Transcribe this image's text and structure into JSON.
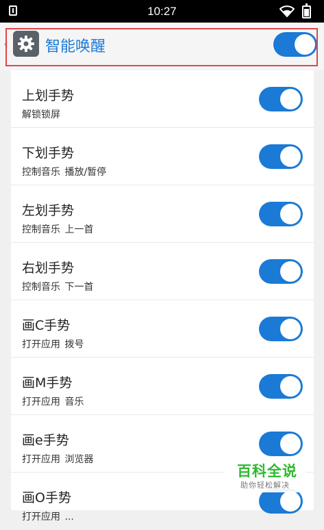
{
  "status_bar": {
    "time": "10:27"
  },
  "header": {
    "title": "智能唤醒",
    "toggle_on": true
  },
  "items": [
    {
      "title": "上划手势",
      "subtitle": "解锁锁屏",
      "toggle_on": true
    },
    {
      "title": "下划手势",
      "subtitle": "控制音乐 播放/暂停",
      "toggle_on": true
    },
    {
      "title": "左划手势",
      "subtitle": "控制音乐 上一首",
      "toggle_on": true
    },
    {
      "title": "右划手势",
      "subtitle": "控制音乐 下一首",
      "toggle_on": true
    },
    {
      "title": "画C手势",
      "subtitle": "打开应用 拨号",
      "toggle_on": true
    },
    {
      "title": "画M手势",
      "subtitle": "打开应用 音乐",
      "toggle_on": true
    },
    {
      "title": "画e手势",
      "subtitle": "打开应用 浏览器",
      "toggle_on": true
    },
    {
      "title": "画O手势",
      "subtitle": "打开应用 ...",
      "toggle_on": true
    }
  ],
  "watermark": {
    "title": "百科全说",
    "subtitle": "助你轻松解决"
  },
  "colors": {
    "accent": "#1a7ad6",
    "highlight": "#e0444a",
    "watermark": "#2eb82e"
  }
}
